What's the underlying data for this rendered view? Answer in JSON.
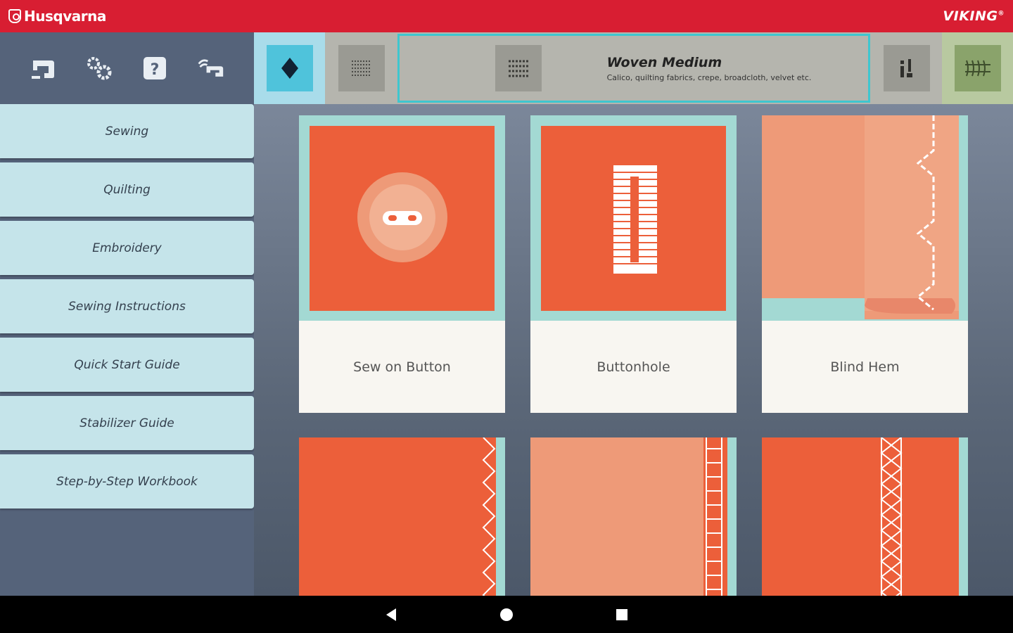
{
  "header": {
    "brand_left": "Husqvarna",
    "brand_right": "VIKING",
    "brand_right_mark": "®",
    "bg_color": "#d81e32"
  },
  "toolbar": {
    "icons": [
      "sewing-machine-icon",
      "settings-gears-icon",
      "help-icon",
      "machine-connect-icon"
    ]
  },
  "menu": {
    "items": [
      {
        "label": "Sewing"
      },
      {
        "label": "Quilting"
      },
      {
        "label": "Embroidery"
      },
      {
        "label": "Sewing Instructions"
      },
      {
        "label": "Quick Start Guide"
      },
      {
        "label": "Stabilizer Guide"
      },
      {
        "label": "Step-by-Step Workbook"
      }
    ]
  },
  "fabric": {
    "title": "Woven Medium",
    "description": "Calico, quilting fabrics, crepe, broadcloth, velvet etc."
  },
  "techniques": {
    "tiles": [
      {
        "label": "Sew on Button"
      },
      {
        "label": "Buttonhole"
      },
      {
        "label": "Blind Hem"
      }
    ]
  },
  "colors": {
    "accent_orange": "#ec5f3a",
    "menu_bg": "#c5e4ea",
    "teal_highlight": "#3ec6cf"
  }
}
